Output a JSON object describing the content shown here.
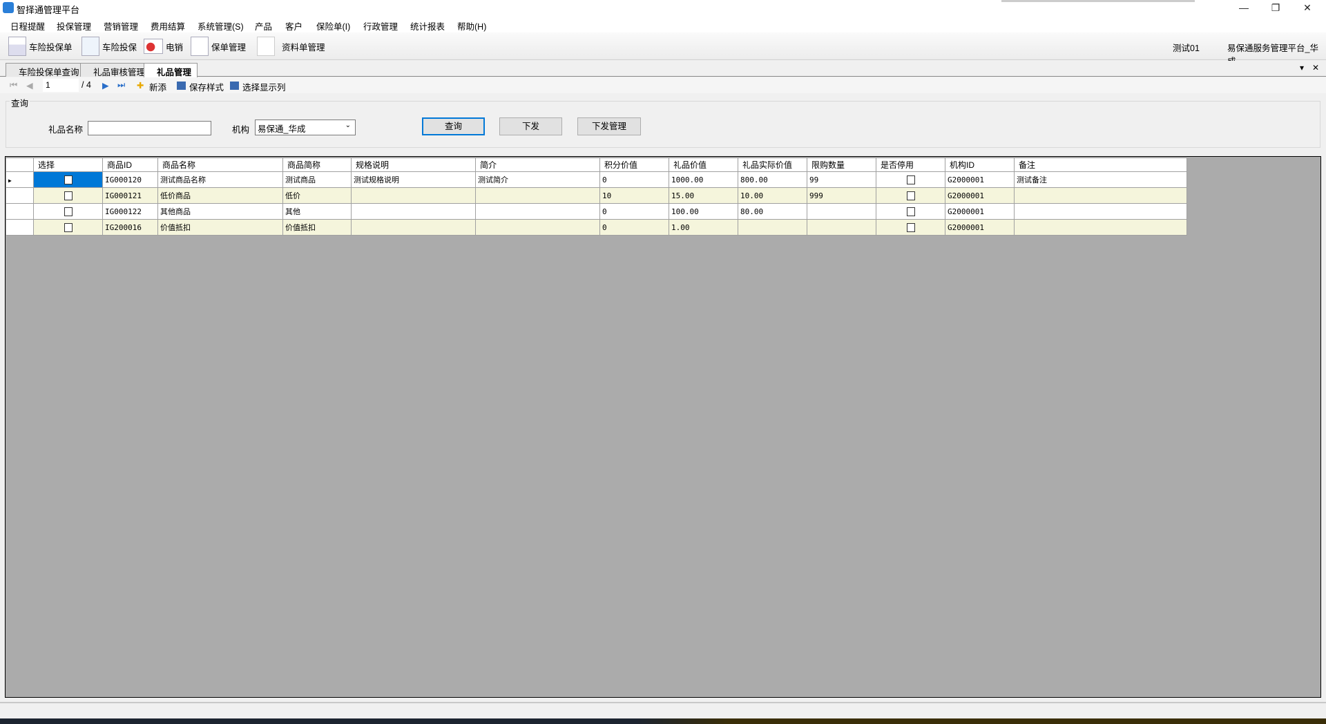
{
  "window": {
    "title": "智择通管理平台",
    "minimize": "—",
    "restore": "❐",
    "close": "✕"
  },
  "menu": [
    "日程提醒",
    "投保管理",
    "营销管理",
    "费用结算",
    "系统管理(S)",
    "产品",
    "客户",
    "保险单(I)",
    "行政管理",
    "统计报表",
    "帮助(H)"
  ],
  "toolbar": {
    "items": [
      {
        "label": "车险投保单",
        "icon": "spreadsheet-icon"
      },
      {
        "label": "车险投保",
        "icon": "document-pen-icon"
      },
      {
        "label": "电销",
        "icon": "contact-card-icon"
      },
      {
        "label": "保单管理",
        "icon": "checklist-pen-icon"
      },
      {
        "label": "资料单管理",
        "icon": "blank-document-icon"
      }
    ],
    "user": "测试01",
    "org": "易保通服务管理平台_华成"
  },
  "tabs": [
    {
      "label": "车险投保单查询",
      "active": false
    },
    {
      "label": "礼品审核管理",
      "active": false
    },
    {
      "label": "礼品管理",
      "active": true
    }
  ],
  "tab_controls": {
    "dropdown": "▾",
    "close": "✕"
  },
  "nav": {
    "page": "1",
    "total": "/ 4",
    "add": "新添",
    "save_style": "保存样式",
    "select_columns": "选择显示列"
  },
  "query": {
    "group_label": "查询",
    "gift_name_label": "礼品名称",
    "gift_name_value": "",
    "org_label": "机构",
    "org_value": "易保通_华成",
    "search": "查询",
    "dispatch": "下发",
    "dispatch_manage": "下发管理"
  },
  "grid": {
    "columns": [
      "选择",
      "商品ID",
      "商品名称",
      "商品简称",
      "规格说明",
      "简介",
      "积分价值",
      "礼品价值",
      "礼品实际价值",
      "限购数量",
      "是否停用",
      "机构ID",
      "备注"
    ],
    "rows": [
      {
        "id": "IG000120",
        "name": "测试商品名称",
        "short": "测试商品",
        "spec": "测试规格说明",
        "intro": "测试简介",
        "points": "0",
        "value": "1000.00",
        "actual": "800.00",
        "limit": "99",
        "org": "G2000001",
        "note": "测试备注",
        "selected": false,
        "disabled": false
      },
      {
        "id": "IG000121",
        "name": "低价商品",
        "short": "低价",
        "spec": "",
        "intro": "",
        "points": "10",
        "value": "15.00",
        "actual": "10.00",
        "limit": "999",
        "org": "G2000001",
        "note": "",
        "selected": false,
        "disabled": false
      },
      {
        "id": "IG000122",
        "name": "其他商品",
        "short": "其他",
        "spec": "",
        "intro": "",
        "points": "0",
        "value": "100.00",
        "actual": "80.00",
        "limit": "",
        "org": "G2000001",
        "note": "",
        "selected": false,
        "disabled": false
      },
      {
        "id": "IG200016",
        "name": "价值抵扣",
        "short": "价值抵扣",
        "spec": "",
        "intro": "",
        "points": "0",
        "value": "1.00",
        "actual": "",
        "limit": "",
        "org": "G2000001",
        "note": "",
        "selected": false,
        "disabled": false
      }
    ]
  }
}
